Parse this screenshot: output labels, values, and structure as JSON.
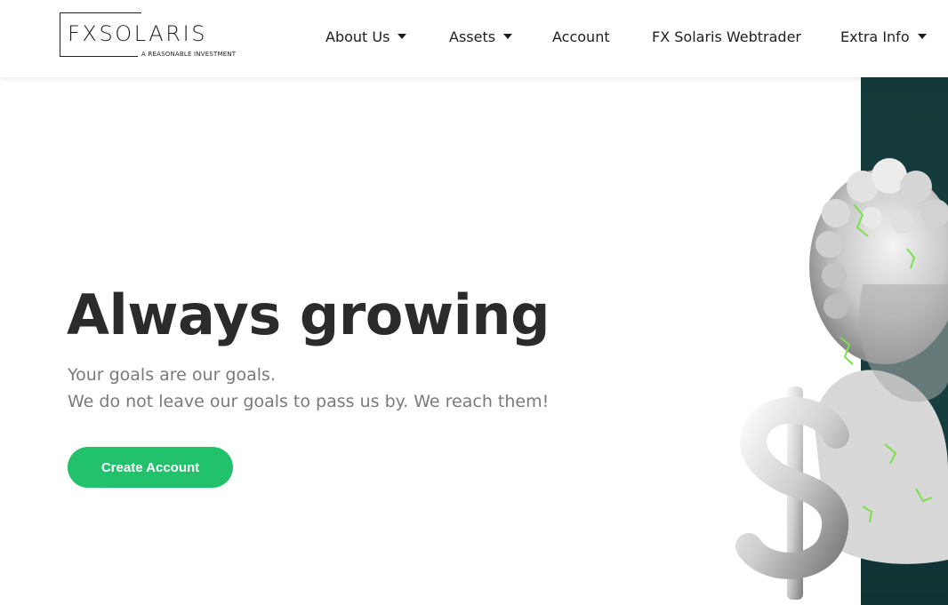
{
  "logo": {
    "name": "FXSOLARIS",
    "tagline": "A REASONABLE INVESTMENT"
  },
  "nav": {
    "items": [
      {
        "label": "About Us",
        "dropdown": true
      },
      {
        "label": "Assets",
        "dropdown": true
      },
      {
        "label": "Account",
        "dropdown": false
      },
      {
        "label": "FX Solaris Webtrader",
        "dropdown": false
      },
      {
        "label": "Extra Info",
        "dropdown": true
      }
    ]
  },
  "hero": {
    "title": "Always growing",
    "subtitle_line1": "Your goals are our goals.",
    "subtitle_line2": "We do not leave our goals to pass us by. We reach them!",
    "cta_label": "Create Account"
  },
  "colors": {
    "accent": "#22c16b",
    "panel": "#14393a",
    "title": "#2b2b2b",
    "subtitle": "#7a7a7a"
  },
  "icons": {
    "dropdown": "caret-down-icon",
    "hero_image": "statue-with-dollar-sign"
  }
}
